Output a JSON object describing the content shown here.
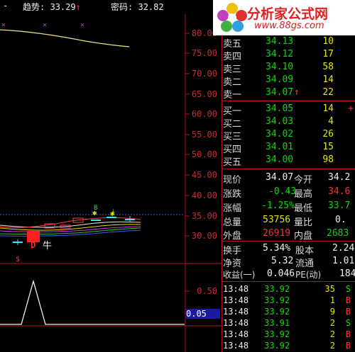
{
  "header": {
    "dash": "-",
    "trend_label": "趋势:",
    "trend_value": "33.29",
    "trend_arrow": "↑",
    "password_label": "密码:",
    "password_value": "32.82"
  },
  "logo": {
    "title": "分析家公式网",
    "url": "www.88gs.com"
  },
  "axis": {
    "upper": [
      "80.00",
      "75.00",
      "70.00",
      "65.00",
      "60.00",
      "55.00",
      "50.00",
      "45.00",
      "40.00",
      "35.00",
      "30.00"
    ],
    "lower": [
      "0.50"
    ],
    "indicator_value": "0.05"
  },
  "chart_labels": {
    "dollar": "$",
    "bull": "牛",
    "d_marker": "D"
  },
  "order_book": {
    "asks": [
      {
        "label": "卖五",
        "price": "34.13",
        "vol": "10"
      },
      {
        "label": "卖四",
        "price": "34.12",
        "vol": "17"
      },
      {
        "label": "卖三",
        "price": "34.10",
        "vol": "58"
      },
      {
        "label": "卖二",
        "price": "34.09",
        "vol": "14"
      },
      {
        "label": "卖一",
        "price": "34.07",
        "vol": "22",
        "arrow": "↑"
      }
    ],
    "bids": [
      {
        "label": "买一",
        "price": "34.05",
        "vol": "14",
        "extra": "+"
      },
      {
        "label": "买二",
        "price": "34.03",
        "vol": "4"
      },
      {
        "label": "买三",
        "price": "34.02",
        "vol": "26"
      },
      {
        "label": "买四",
        "price": "34.01",
        "vol": "15"
      },
      {
        "label": "买五",
        "price": "34.00",
        "vol": "98"
      }
    ]
  },
  "quote": [
    {
      "l1": "现价",
      "v1": "34.07",
      "l2": "今开",
      "v2": "34.2"
    },
    {
      "l1": "涨跌",
      "v1": "-0.43",
      "l2": "最高",
      "v2": "34.6"
    },
    {
      "l1": "涨幅",
      "v1": "-1.25%",
      "l2": "最低",
      "v2": "33.7"
    },
    {
      "l1": "总量",
      "v1": "53756",
      "l2": "量比",
      "v2": "0."
    },
    {
      "l1": "外盘",
      "v1": "26919",
      "l2": "内盘",
      "v2": "2683"
    }
  ],
  "finance": [
    {
      "l1": "换手",
      "v1": "5.34%",
      "l2": "股本",
      "v2": "2.24"
    },
    {
      "l1": "净资",
      "v1": "5.32",
      "l2": "流通",
      "v2": "1.01"
    },
    {
      "l1": "收益(一)",
      "v1": "0.046",
      "l2": "PE(动)",
      "v2": "184"
    }
  ],
  "ticks": [
    {
      "time": "13:48",
      "price": "33.92",
      "vol": "35",
      "side": "S"
    },
    {
      "time": "13:48",
      "price": "33.92",
      "vol": "1",
      "side": "B"
    },
    {
      "time": "13:48",
      "price": "33.92",
      "vol": "9",
      "side": "B"
    },
    {
      "time": "13:48",
      "price": "33.91",
      "vol": "2",
      "side": "S"
    },
    {
      "time": "13:48",
      "price": "33.92",
      "vol": "2",
      "side": "B"
    },
    {
      "time": "13:48",
      "price": "33.92",
      "vol": "2",
      "side": "B"
    }
  ]
}
